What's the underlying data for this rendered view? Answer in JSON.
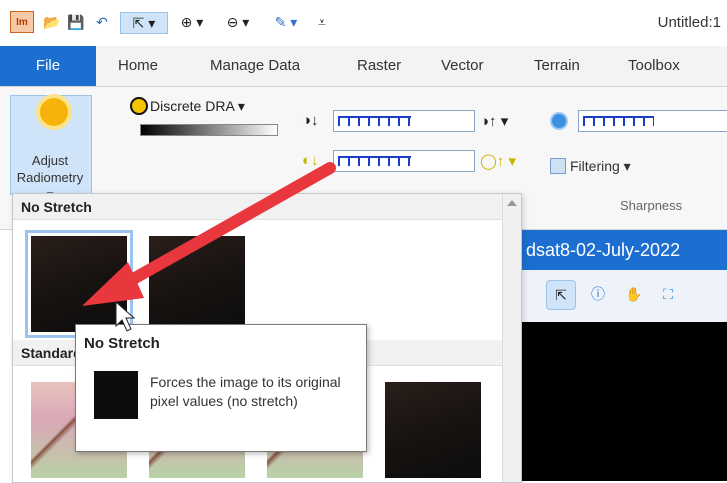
{
  "app": {
    "logo_text": "Im",
    "window_title": "Untitled:1",
    "accent": "#1c6fd1"
  },
  "qat": {
    "icons": [
      "open-folder-icon",
      "save-icon",
      "undo-icon",
      "select-icon",
      "zoom-in-icon",
      "zoom-out-icon",
      "erase-icon",
      "customize-icon"
    ]
  },
  "tabs": [
    "File",
    "Home",
    "Manage Data",
    "Raster",
    "Vector",
    "Terrain",
    "Toolbox"
  ],
  "ribbon": {
    "adjust_radiometry_label": "Adjust Radiometry",
    "dra_label": "Discrete DRA",
    "filtering_label": "Filtering",
    "sharpness_label": "Sharpness",
    "brightness_level": 0.55,
    "contrast_level": 0.55,
    "sharpness_level": 0.5
  },
  "gallery": {
    "section1_title": "No Stretch",
    "section2_title": "Standard"
  },
  "viewer": {
    "title": "dsat8-02-July-2022",
    "tool_icons": [
      "select-arrow-icon",
      "info-icon",
      "pan-hand-icon",
      "fit-extent-icon"
    ]
  },
  "tooltip": {
    "title": "No Stretch",
    "description": "Forces the image to its original pixel values (no stretch)"
  }
}
